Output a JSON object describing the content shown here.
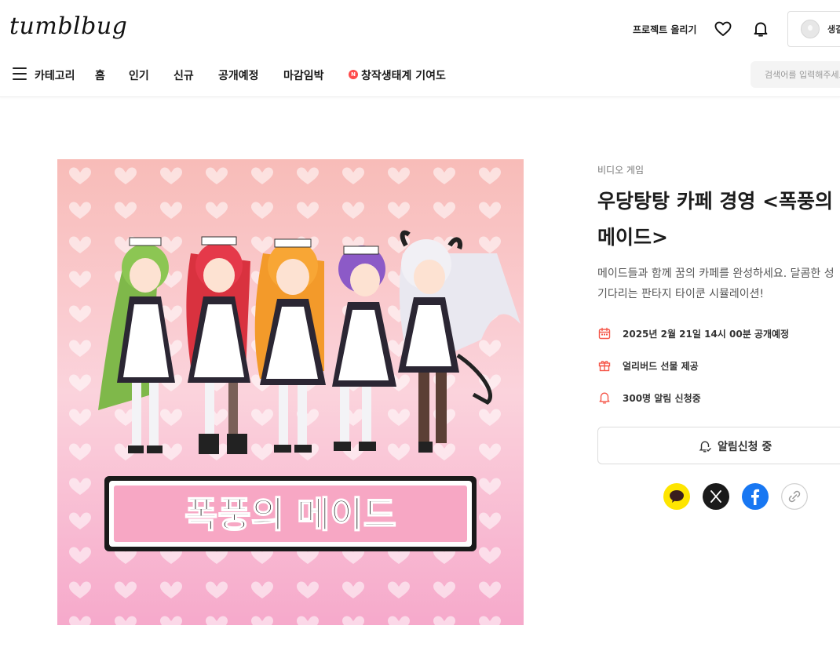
{
  "header": {
    "logo": "tumblbug",
    "upload_label": "프로젝트 올리기",
    "profile_name": "생길"
  },
  "nav": {
    "category_label": "카테고리",
    "items": [
      "홈",
      "인기",
      "신규",
      "공개예정",
      "마감임박"
    ],
    "special_badge": "N",
    "special_label": "창작생태계 기여도",
    "search_placeholder": "검색어를 입력해주세요"
  },
  "hero": {
    "title_art_text": "폭풍의 메이드"
  },
  "project": {
    "category": "비디오 게임",
    "title_line1": "우당탕탕 카페 경영 <폭풍의",
    "title_line2": "메이드>",
    "description_line1": "메이드들과 함께 꿈의 카페를 완성하세요. 달콤한 성",
    "description_line2": "기다리는 판타지 타이쿤 시뮬레이션!",
    "info": [
      {
        "icon": "calendar-icon",
        "text": "2025년 2월 21일 14시 00분 공개예정"
      },
      {
        "icon": "gift-icon",
        "text": "얼리버드 선물 제공"
      },
      {
        "icon": "bell-icon",
        "text": "300명 알림 신청중"
      }
    ],
    "notify_label": "알림신청 중",
    "share": [
      "kakaotalk-icon",
      "x-icon",
      "facebook-icon",
      "link-icon"
    ]
  },
  "colors": {
    "accent": "#f5574a",
    "kakao": "#fee500",
    "facebook": "#1877f2",
    "hero_pink": "#f9b5c8"
  }
}
